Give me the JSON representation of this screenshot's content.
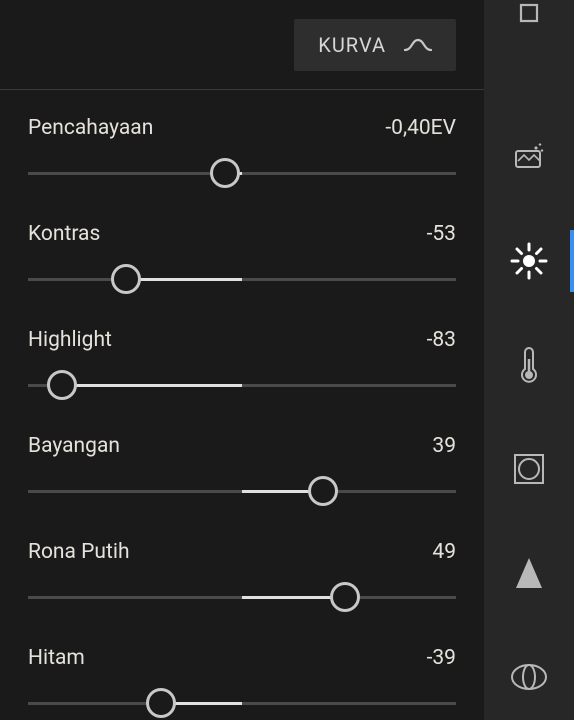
{
  "header": {
    "tab_label": "KURVA"
  },
  "sliders": [
    {
      "label": "Pencahayaan",
      "value_text": "-0,40EV",
      "value": -0.4,
      "min": -5,
      "max": 5,
      "handle_pct": 46
    },
    {
      "label": "Kontras",
      "value_text": "-53",
      "value": -53,
      "min": -100,
      "max": 100,
      "handle_pct": 23
    },
    {
      "label": "Highlight",
      "value_text": "-83",
      "value": -83,
      "min": -100,
      "max": 100,
      "handle_pct": 8
    },
    {
      "label": "Bayangan",
      "value_text": "39",
      "value": 39,
      "min": -100,
      "max": 100,
      "handle_pct": 69
    },
    {
      "label": "Rona Putih",
      "value_text": "49",
      "value": 49,
      "min": -100,
      "max": 100,
      "handle_pct": 74
    },
    {
      "label": "Hitam",
      "value_text": "-39",
      "value": -39,
      "min": -100,
      "max": 100,
      "handle_pct": 31
    }
  ],
  "right_rail": {
    "active_index": 1,
    "items": [
      {
        "name": "crop-icon"
      },
      {
        "name": "healing-icon"
      },
      {
        "name": "light-icon"
      },
      {
        "name": "color-icon"
      },
      {
        "name": "detail-icon"
      },
      {
        "name": "geometry-icon"
      },
      {
        "name": "lens-icon"
      }
    ]
  }
}
